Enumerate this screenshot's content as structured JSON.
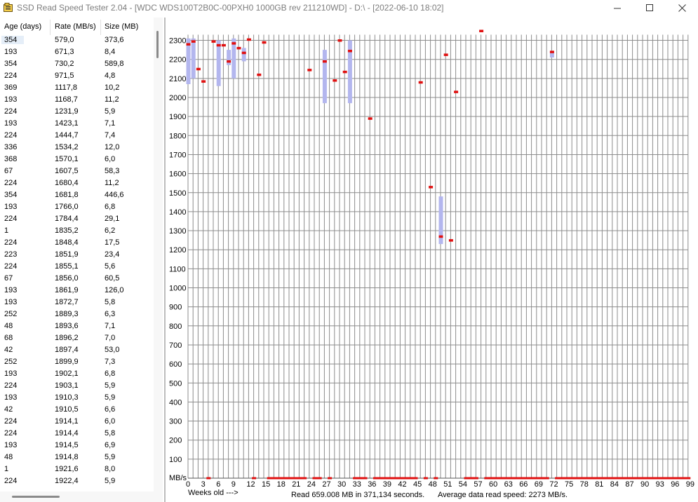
{
  "window": {
    "title": "SSD Read Speed Tester 2.04 - [WDC WDS100T2B0C-00PXH0 1000GB rev 211210WD] - D:\\ - [2022-06-10 18:02]",
    "app_icon": "folder-icon",
    "minimize_icon": "minimize-icon",
    "maximize_icon": "maximize-icon",
    "close_icon": "close-icon"
  },
  "table": {
    "headers": [
      "Age (days)",
      "Rate (MB/s)",
      "Size (MB)"
    ],
    "rows": [
      [
        "354",
        "579,0",
        "373,6"
      ],
      [
        "193",
        "671,3",
        "8,4"
      ],
      [
        "354",
        "730,2",
        "589,8"
      ],
      [
        "224",
        "971,5",
        "4,8"
      ],
      [
        "369",
        "1117,8",
        "10,2"
      ],
      [
        "193",
        "1168,7",
        "11,2"
      ],
      [
        "224",
        "1231,9",
        "5,9"
      ],
      [
        "193",
        "1423,1",
        "7,1"
      ],
      [
        "224",
        "1444,7",
        "7,4"
      ],
      [
        "336",
        "1534,2",
        "12,0"
      ],
      [
        "368",
        "1570,1",
        "6,0"
      ],
      [
        "67",
        "1607,5",
        "58,3"
      ],
      [
        "224",
        "1680,4",
        "11,2"
      ],
      [
        "354",
        "1681,8",
        "446,6"
      ],
      [
        "193",
        "1766,0",
        "6,8"
      ],
      [
        "224",
        "1784,4",
        "29,1"
      ],
      [
        "1",
        "1835,2",
        "6,2"
      ],
      [
        "224",
        "1848,4",
        "17,5"
      ],
      [
        "223",
        "1851,9",
        "23,4"
      ],
      [
        "224",
        "1855,1",
        "5,6"
      ],
      [
        "67",
        "1856,0",
        "60,5"
      ],
      [
        "193",
        "1861,9",
        "126,0"
      ],
      [
        "193",
        "1872,7",
        "5,8"
      ],
      [
        "252",
        "1889,3",
        "6,3"
      ],
      [
        "48",
        "1893,6",
        "7,1"
      ],
      [
        "68",
        "1896,2",
        "7,0"
      ],
      [
        "42",
        "1897,4",
        "53,0"
      ],
      [
        "252",
        "1899,9",
        "7,3"
      ],
      [
        "193",
        "1902,1",
        "6,8"
      ],
      [
        "224",
        "1903,1",
        "5,9"
      ],
      [
        "193",
        "1910,3",
        "5,9"
      ],
      [
        "42",
        "1910,5",
        "6,6"
      ],
      [
        "224",
        "1914,1",
        "6,0"
      ],
      [
        "224",
        "1914,4",
        "5,8"
      ],
      [
        "193",
        "1914,5",
        "6,9"
      ],
      [
        "48",
        "1914,8",
        "5,9"
      ],
      [
        "1",
        "1921,6",
        "8,0"
      ],
      [
        "224",
        "1922,4",
        "5,9"
      ]
    ]
  },
  "chart_data": {
    "type": "scatter",
    "ylabel": "MB/s",
    "xlabel": "Weeks old --->",
    "ylim": [
      0,
      2300
    ],
    "yticks": [
      100,
      200,
      300,
      400,
      500,
      600,
      700,
      800,
      900,
      1000,
      1100,
      1200,
      1300,
      1400,
      1500,
      1600,
      1700,
      1800,
      1900,
      2000,
      2100,
      2200,
      2300
    ],
    "xticks": [
      0,
      3,
      6,
      9,
      12,
      15,
      18,
      21,
      24,
      27,
      30,
      33,
      36,
      39,
      42,
      45,
      48,
      51,
      54,
      57,
      60,
      63,
      66,
      69,
      72,
      75,
      78,
      81,
      84,
      87,
      90,
      93,
      96,
      99
    ],
    "xlim": [
      0,
      99
    ],
    "grid": true,
    "series": [
      {
        "color": "#e01010",
        "points": [
          [
            0,
            2280
          ],
          [
            1,
            2295
          ],
          [
            2,
            2150
          ],
          [
            3,
            2085
          ],
          [
            5,
            2295
          ],
          [
            6,
            2275
          ],
          [
            7,
            2275
          ],
          [
            8,
            2190
          ],
          [
            9,
            2285
          ],
          [
            10,
            2260
          ],
          [
            11,
            2235
          ],
          [
            12,
            2305
          ],
          [
            14,
            2120
          ],
          [
            15,
            2290
          ],
          [
            24,
            2145
          ],
          [
            27,
            2190
          ],
          [
            29,
            2090
          ],
          [
            30,
            2300
          ],
          [
            31,
            2135
          ],
          [
            32,
            2245
          ],
          [
            36,
            1890
          ],
          [
            46,
            2080
          ],
          [
            48,
            1530
          ],
          [
            50,
            1270
          ],
          [
            51,
            2225
          ],
          [
            52,
            1250
          ],
          [
            53,
            2030
          ],
          [
            58,
            2350
          ],
          [
            72,
            2240
          ]
        ]
      }
    ],
    "ranges": {
      "color": "#b3b6ee",
      "bars": [
        [
          0,
          2070,
          2310
        ],
        [
          1,
          2100,
          2310
        ],
        [
          6,
          2060,
          2300
        ],
        [
          8,
          2170,
          2250
        ],
        [
          9,
          2100,
          2310
        ],
        [
          11,
          2190,
          2260
        ],
        [
          27,
          1970,
          2250
        ],
        [
          32,
          1970,
          2300
        ],
        [
          50,
          1230,
          1480
        ],
        [
          72,
          2210,
          2245
        ]
      ]
    },
    "bottom_marks": [
      [
        4,
        4
      ],
      [
        13,
        13
      ],
      [
        16,
        23
      ],
      [
        25,
        26
      ],
      [
        28,
        28
      ],
      [
        33,
        35
      ],
      [
        37,
        45
      ],
      [
        47,
        47
      ],
      [
        49,
        49
      ],
      [
        55,
        57
      ],
      [
        59,
        71
      ],
      [
        73,
        99
      ]
    ],
    "footer": {
      "read_text": "Read 659.008 MB in 371,134 seconds.",
      "avg_text": "Average data read speed: 2273 MB/s."
    }
  }
}
